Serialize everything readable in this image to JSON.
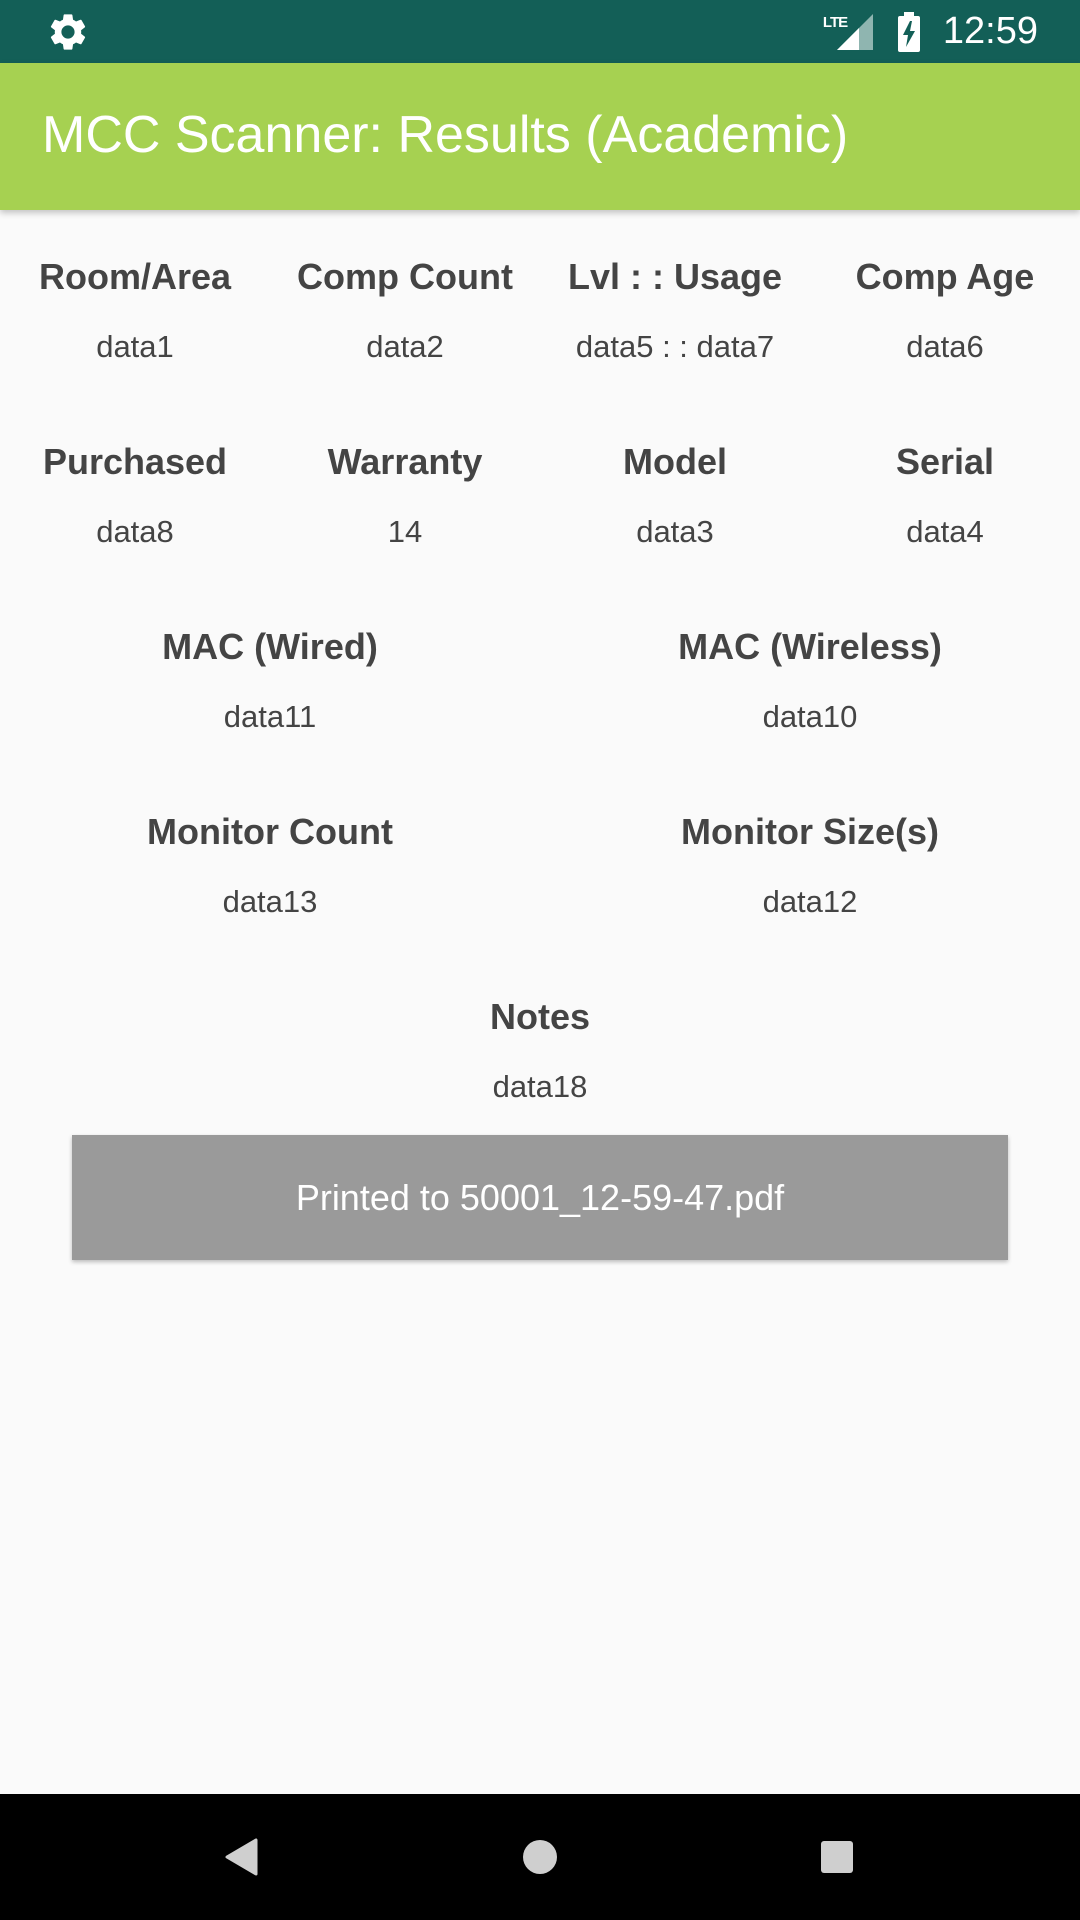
{
  "status_bar": {
    "time": "12:59",
    "network": "LTE",
    "icons": [
      "gear-icon",
      "lte-signal-icon",
      "battery-charging-icon"
    ],
    "bg_color": "#135f57"
  },
  "app_bar": {
    "title": "MCC Scanner: Results (Academic)",
    "bg_color": "#a6d151"
  },
  "fields": {
    "room_area": {
      "label": "Room/Area",
      "value": "data1"
    },
    "comp_count": {
      "label": "Comp Count",
      "value": "data2"
    },
    "lvl_usage": {
      "label": "Lvl : : Usage",
      "value": "data5 : : data7"
    },
    "comp_age": {
      "label": "Comp Age",
      "value": "data6"
    },
    "purchased": {
      "label": "Purchased",
      "value": "data8"
    },
    "warranty": {
      "label": "Warranty",
      "value": "14"
    },
    "model": {
      "label": "Model",
      "value": "data3"
    },
    "serial": {
      "label": "Serial",
      "value": "data4"
    },
    "mac_wired": {
      "label": "MAC (Wired)",
      "value": "data11"
    },
    "mac_wireless": {
      "label": "MAC (Wireless)",
      "value": "data10"
    },
    "monitor_count": {
      "label": "Monitor Count",
      "value": "data13"
    },
    "monitor_sizes": {
      "label": "Monitor Size(s)",
      "value": "data12"
    },
    "notes": {
      "label": "Notes",
      "value": "data18"
    }
  },
  "print_button": {
    "label": "Printed to 50001_12-59-47.pdf",
    "bg_color": "#9a9a9a"
  },
  "nav_bar": {
    "icons": [
      "back-icon",
      "home-icon",
      "recents-icon"
    ]
  }
}
